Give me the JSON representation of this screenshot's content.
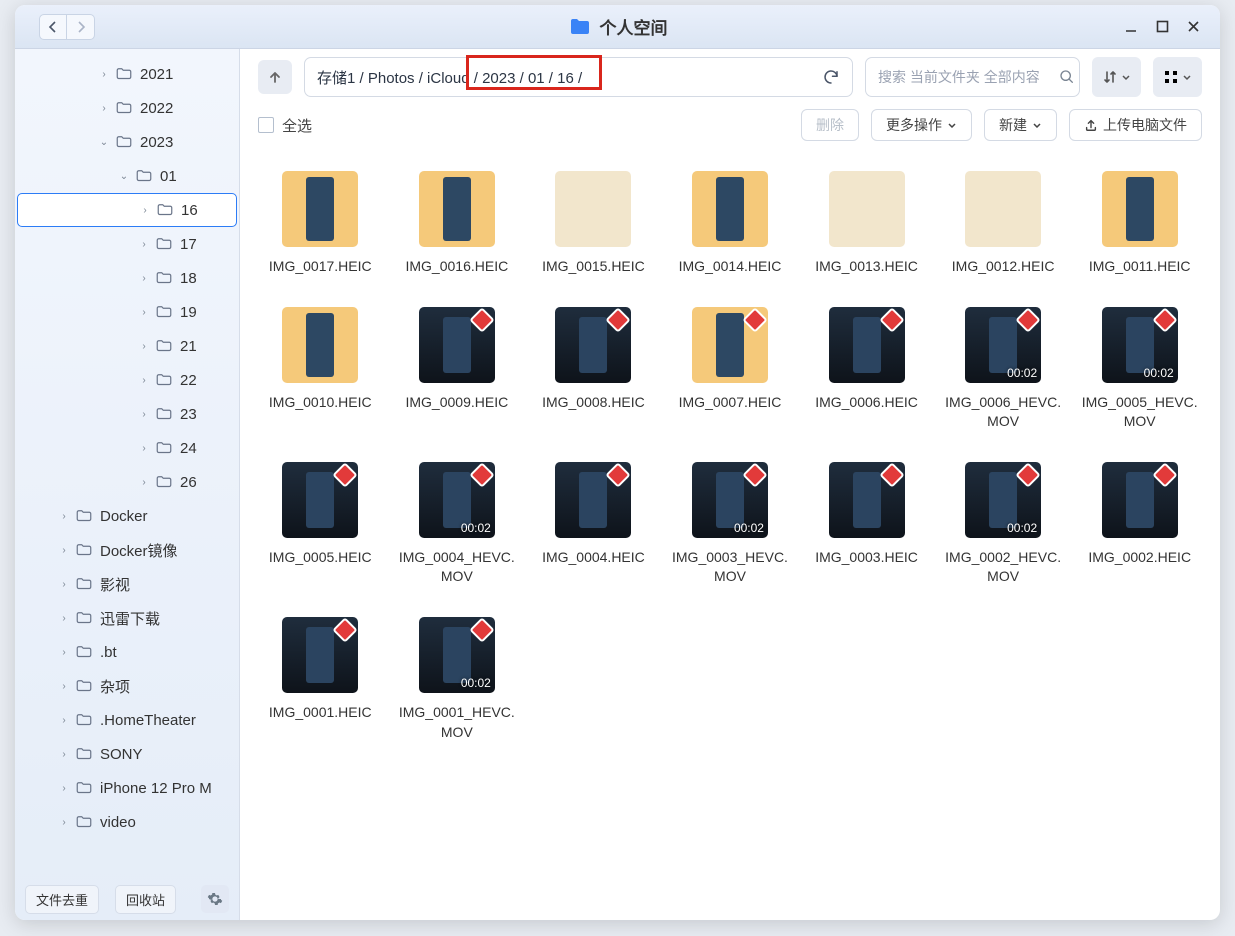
{
  "window": {
    "title": "个人空间"
  },
  "toolbar": {
    "path": "存储1 / Photos / iCloud / 2023 / 01 / 16 /",
    "searchPlaceholder": "搜索 当前文件夹 全部内容",
    "selectAll": "全选",
    "delete": "删除",
    "moreOps": "更多操作",
    "new": "新建",
    "upload": "上传电脑文件"
  },
  "sidebar": {
    "tree": [
      {
        "label": "2021",
        "depth": 3,
        "expanded": false
      },
      {
        "label": "2022",
        "depth": 3,
        "expanded": false
      },
      {
        "label": "2023",
        "depth": 3,
        "expanded": true
      },
      {
        "label": "01",
        "depth": 4,
        "expanded": true
      },
      {
        "label": "16",
        "depth": 5,
        "expanded": false,
        "selected": true
      },
      {
        "label": "17",
        "depth": 5,
        "expanded": false
      },
      {
        "label": "18",
        "depth": 5,
        "expanded": false
      },
      {
        "label": "19",
        "depth": 5,
        "expanded": false
      },
      {
        "label": "21",
        "depth": 5,
        "expanded": false
      },
      {
        "label": "22",
        "depth": 5,
        "expanded": false
      },
      {
        "label": "23",
        "depth": 5,
        "expanded": false
      },
      {
        "label": "24",
        "depth": 5,
        "expanded": false
      },
      {
        "label": "26",
        "depth": 5,
        "expanded": false
      },
      {
        "label": "Docker",
        "depth": 1,
        "expanded": false
      },
      {
        "label": "Docker镜像",
        "depth": 1,
        "expanded": false
      },
      {
        "label": "影视",
        "depth": 1,
        "expanded": false
      },
      {
        "label": "迅雷下载",
        "depth": 1,
        "expanded": false
      },
      {
        "label": ".bt",
        "depth": 1,
        "expanded": false
      },
      {
        "label": "杂项",
        "depth": 1,
        "expanded": false
      },
      {
        "label": ".HomeTheater",
        "depth": 1,
        "expanded": false
      },
      {
        "label": "SONY",
        "depth": 1,
        "expanded": false
      },
      {
        "label": "iPhone 12 Pro M",
        "depth": 1,
        "expanded": false
      },
      {
        "label": "video",
        "depth": 1,
        "expanded": false
      }
    ],
    "footer": {
      "dedupe": "文件去重",
      "recycle": "回收站"
    }
  },
  "files": [
    {
      "name": "IMG_0017.HEIC",
      "thumb": "yellow"
    },
    {
      "name": "IMG_0016.HEIC",
      "thumb": "yellow"
    },
    {
      "name": "IMG_0015.HEIC",
      "thumb": "light"
    },
    {
      "name": "IMG_0014.HEIC",
      "thumb": "yellow"
    },
    {
      "name": "IMG_0013.HEIC",
      "thumb": "light"
    },
    {
      "name": "IMG_0012.HEIC",
      "thumb": "light"
    },
    {
      "name": "IMG_0011.HEIC",
      "thumb": "yellow"
    },
    {
      "name": "IMG_0010.HEIC",
      "thumb": "yellow"
    },
    {
      "name": "IMG_0009.HEIC",
      "thumb": "dark",
      "badge": true
    },
    {
      "name": "IMG_0008.HEIC",
      "thumb": "dark",
      "badge": true
    },
    {
      "name": "IMG_0007.HEIC",
      "thumb": "yellow",
      "badge": true
    },
    {
      "name": "IMG_0006.HEIC",
      "thumb": "dark",
      "badge": true
    },
    {
      "name": "IMG_0006_HEVC.MOV",
      "thumb": "dark",
      "badge": true,
      "duration": "00:02"
    },
    {
      "name": "IMG_0005_HEVC.MOV",
      "thumb": "dark",
      "badge": true,
      "duration": "00:02"
    },
    {
      "name": "IMG_0005.HEIC",
      "thumb": "dark",
      "badge": true
    },
    {
      "name": "IMG_0004_HEVC.MOV",
      "thumb": "dark",
      "badge": true,
      "duration": "00:02"
    },
    {
      "name": "IMG_0004.HEIC",
      "thumb": "dark",
      "badge": true
    },
    {
      "name": "IMG_0003_HEVC.MOV",
      "thumb": "dark",
      "badge": true,
      "duration": "00:02"
    },
    {
      "name": "IMG_0003.HEIC",
      "thumb": "dark",
      "badge": true
    },
    {
      "name": "IMG_0002_HEVC.MOV",
      "thumb": "dark",
      "badge": true,
      "duration": "00:02"
    },
    {
      "name": "IMG_0002.HEIC",
      "thumb": "dark",
      "badge": true
    },
    {
      "name": "IMG_0001.HEIC",
      "thumb": "dark",
      "badge": true
    },
    {
      "name": "IMG_0001_HEVC.MOV",
      "thumb": "dark",
      "badge": true,
      "duration": "00:02"
    }
  ]
}
